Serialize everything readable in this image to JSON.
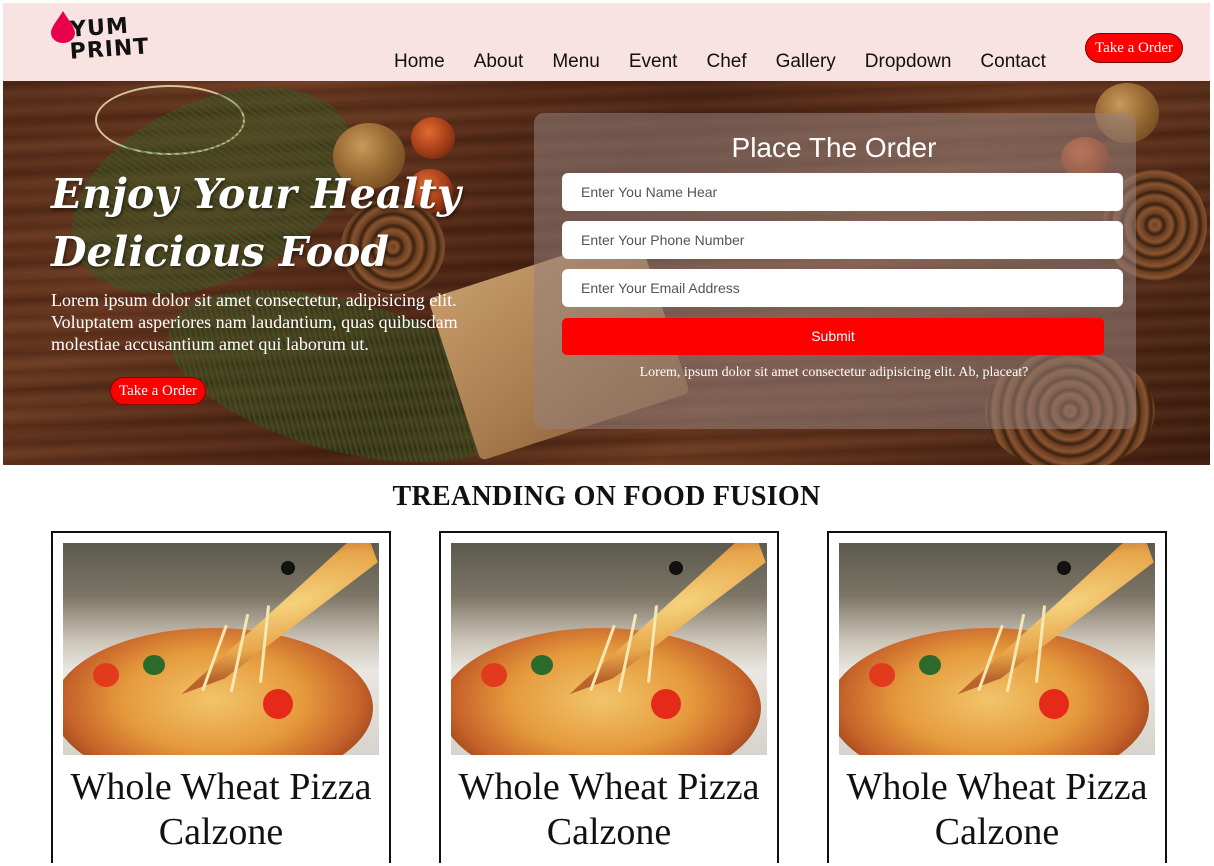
{
  "brand": {
    "logo_line1": "YUM",
    "logo_line2": "PRINT",
    "accent_color": "#ff0000",
    "nav_background": "#f8e2e2"
  },
  "nav": {
    "links": [
      "Home",
      "About",
      "Menu",
      "Event",
      "Chef",
      "Gallery",
      "Dropdown",
      "Contact"
    ],
    "order_button": "Take a Order"
  },
  "hero": {
    "title_line1": "Enjoy Your Healty",
    "title_line2": "Delicious Food",
    "text": "Lorem ipsum dolor sit amet consectetur, adipisicing elit. Voluptatem asperiores nam laudantium, quas quibusdam molestiae accusantium amet qui laborum ut.",
    "order_button": "Take a Order"
  },
  "order_form": {
    "title": "Place The Order",
    "name_placeholder": "Enter You Name Hear",
    "phone_placeholder": "Enter Your Phone Number",
    "email_placeholder": "Enter Your Email Address",
    "submit_label": "Submit",
    "note": "Lorem, ipsum dolor sit amet consectetur adipisicing elit. Ab, placeat?"
  },
  "trending": {
    "title": "TREANDING ON FOOD FUSION",
    "cards": [
      {
        "name": "Whole Wheat Pizza Calzone"
      },
      {
        "name": "Whole Wheat Pizza Calzone"
      },
      {
        "name": "Whole Wheat Pizza Calzone"
      }
    ]
  }
}
